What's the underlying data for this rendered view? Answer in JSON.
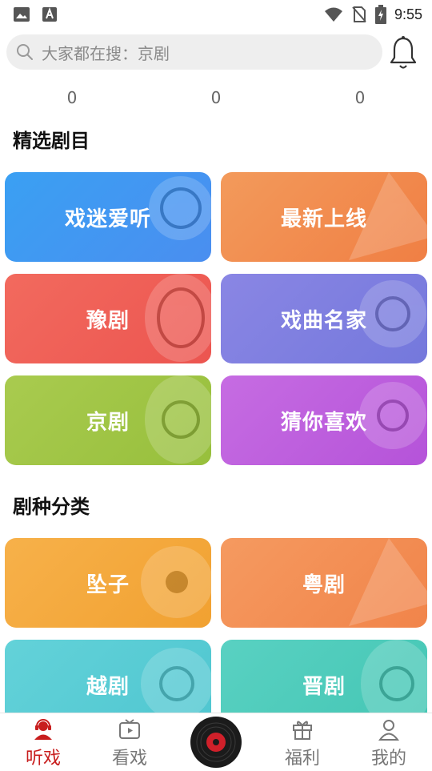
{
  "status_bar": {
    "time": "9:55"
  },
  "search": {
    "placeholder": "大家都在搜：京剧"
  },
  "counters": [
    "0",
    "0",
    "0"
  ],
  "sections": {
    "featured_title": "精选剧目",
    "category_title": "剧种分类"
  },
  "featured": [
    {
      "label": "戏迷爱听",
      "color": "#3aa0f3"
    },
    {
      "label": "最新上线",
      "color": "#f39a5b"
    },
    {
      "label": "豫剧",
      "color": "#f26a5e"
    },
    {
      "label": "戏曲名家",
      "color": "#8a86e4"
    },
    {
      "label": "京剧",
      "color": "#a9cb4f"
    },
    {
      "label": "猜你喜欢",
      "color": "#c66ce2"
    }
  ],
  "categories": [
    {
      "label": "坠子",
      "color": "#f7b14a"
    },
    {
      "label": "粤剧",
      "color": "#f59a60"
    },
    {
      "label": "越剧",
      "color": "#63d2d9"
    },
    {
      "label": "晋剧",
      "color": "#59d1c2"
    }
  ],
  "nav": {
    "items": [
      {
        "label": "听戏",
        "icon": "headphones-person-icon",
        "active": true
      },
      {
        "label": "看戏",
        "icon": "tv-icon",
        "active": false
      },
      {
        "label": "福利",
        "icon": "gift-icon",
        "active": false
      },
      {
        "label": "我的",
        "icon": "user-icon",
        "active": false
      }
    ],
    "accent": "#c81e1e",
    "center_icon": "vinyl-record-icon"
  }
}
